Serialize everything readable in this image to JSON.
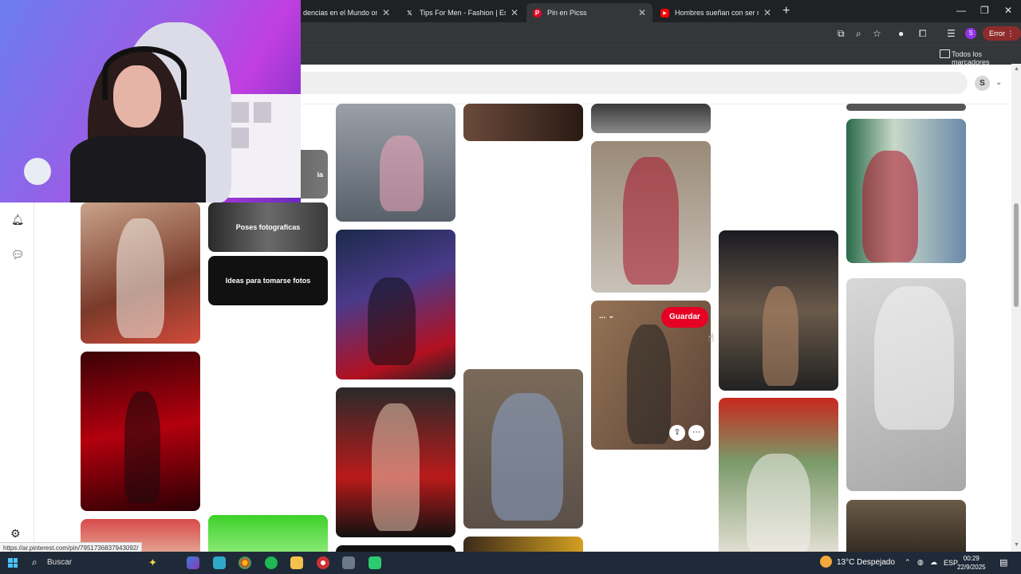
{
  "browser": {
    "tabs": [
      {
        "title": "dencias en el Mundo on X:",
        "icon": "x-logo-icon",
        "active": false
      },
      {
        "title": "Tips For Men - Fashion | Essenti",
        "icon": "x-logo-icon",
        "active": false
      },
      {
        "title": "Pin en Picss",
        "icon": "pinterest-icon",
        "active": true
      },
      {
        "title": "Hombres sueñan con ser masc",
        "icon": "youtube-icon",
        "active": false
      }
    ],
    "new_tab": "+",
    "error_label": "Error",
    "profile_initial": "S",
    "bookmarks_label": "Todos los marcadores"
  },
  "pinterest": {
    "profile_initial": "S",
    "boards": [
      {
        "label": "Poses fotograficas"
      },
      {
        "label": "Ideas para tomarse fotos"
      }
    ],
    "partial_board_text": "ia",
    "hover_pin": {
      "save_label": "Guardar",
      "board_select": "..."
    }
  },
  "status_url": "https://ar.pinterest.com/pin/7951736837943092/",
  "taskbar": {
    "search_label": "Buscar",
    "weather": "13°C  Despejado",
    "language": "ESP",
    "time": "00:29",
    "date": "22/9/2025"
  },
  "colors": {
    "pinterest_red": "#e60023",
    "chrome_dark": "#202124",
    "toolbar": "#35363a",
    "taskbar": "#1f2a38"
  }
}
